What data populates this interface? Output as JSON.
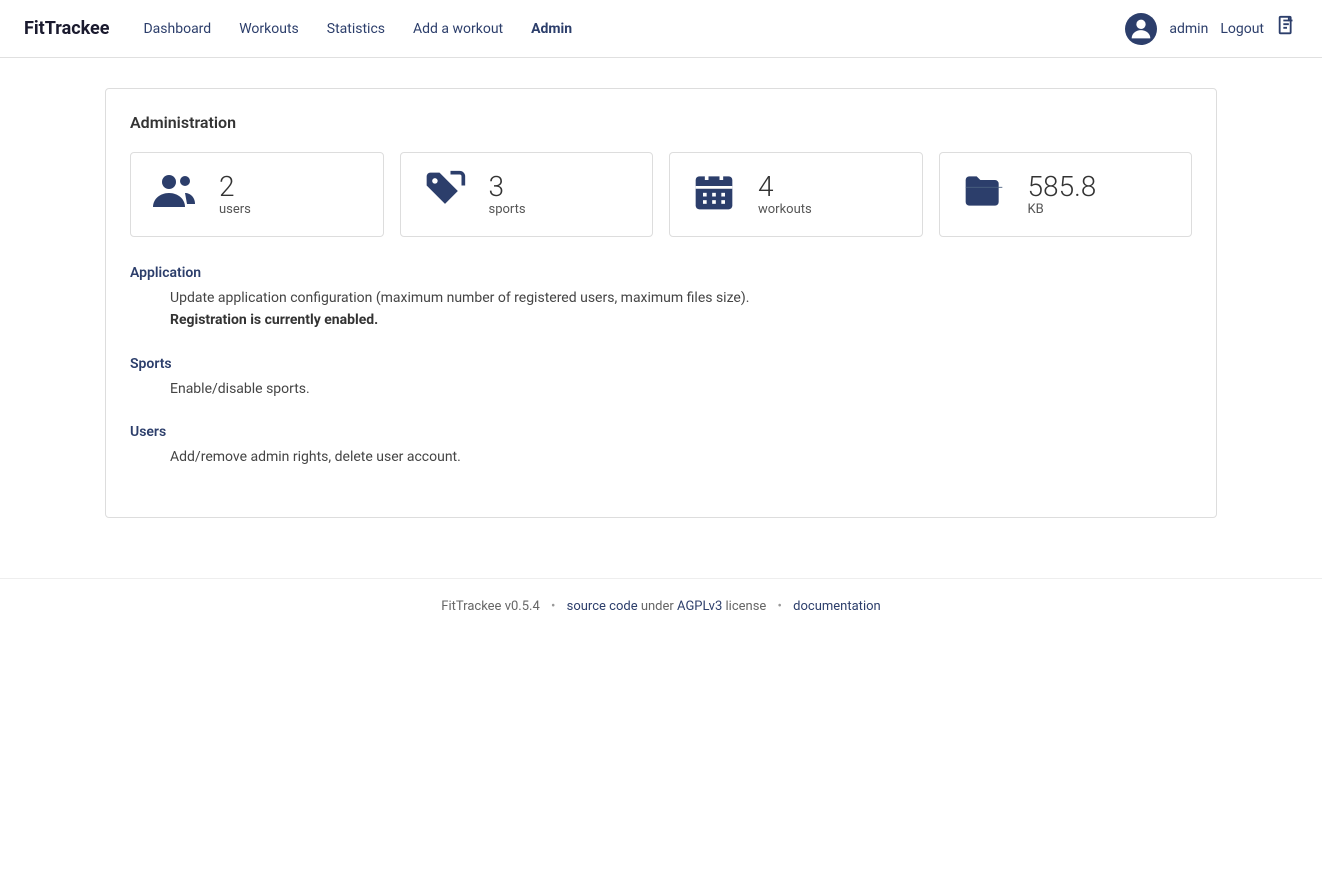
{
  "brand": "FitTrackee",
  "nav": {
    "links": [
      {
        "label": "Dashboard",
        "active": false
      },
      {
        "label": "Workouts",
        "active": false
      },
      {
        "label": "Statistics",
        "active": false
      },
      {
        "label": "Add a workout",
        "active": false
      },
      {
        "label": "Admin",
        "active": true
      }
    ],
    "user": "admin",
    "logout": "Logout"
  },
  "admin": {
    "title": "Administration",
    "stats": [
      {
        "value": "2",
        "label": "users",
        "icon": "users"
      },
      {
        "value": "3",
        "label": "sports",
        "icon": "tag"
      },
      {
        "value": "4",
        "label": "workouts",
        "icon": "calendar"
      },
      {
        "value": "585.8",
        "label": "KB",
        "icon": "folder"
      }
    ],
    "sections": [
      {
        "title": "Application",
        "desc": "Update application configuration (maximum number of registered users, maximum files size).",
        "highlight": "Registration is currently enabled."
      },
      {
        "title": "Sports",
        "desc": "Enable/disable sports.",
        "highlight": ""
      },
      {
        "title": "Users",
        "desc": "Add/remove admin rights, delete user account.",
        "highlight": ""
      }
    ]
  },
  "footer": {
    "brand": "FitTrackee",
    "version": "v0.5.4",
    "source_code_label": "source code",
    "license_name": "AGPLv3",
    "license_text": "license",
    "docs_label": "documentation"
  }
}
